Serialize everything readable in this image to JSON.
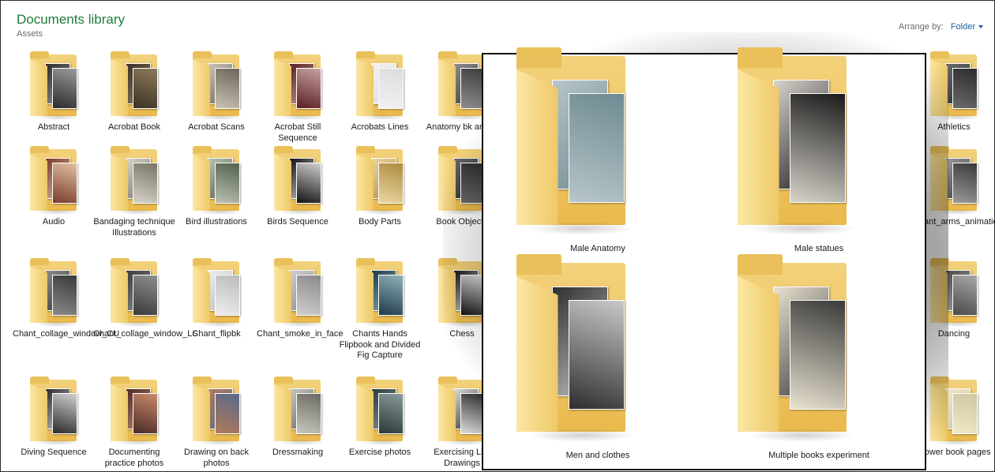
{
  "library": {
    "title": "Documents library",
    "subtitle": "Assets"
  },
  "arrange": {
    "label": "Arrange by:",
    "value": "Folder"
  },
  "folders": [
    {
      "label": "Abstract",
      "thumb": [
        "#2a2a2a",
        "#9a9a9a"
      ]
    },
    {
      "label": "Acrobat Book",
      "thumb": [
        "#3a3226",
        "#8d7a5a"
      ]
    },
    {
      "label": "Acrobat Scans",
      "thumb": [
        "#c9c2b5",
        "#6e6658"
      ]
    },
    {
      "label": "Acrobat Still Sequence",
      "thumb": [
        "#5a1e22",
        "#c7a2a0"
      ]
    },
    {
      "label": "Acrobats Lines",
      "thumb": [
        "#f2f2f2",
        "#dcdcdc"
      ]
    },
    {
      "label": "Anatomy bk artists",
      "thumb": [
        "#8d8d8d",
        "#3c3c3c"
      ]
    },
    {
      "label": "Athletics",
      "thumb": [
        "#6a6a6a",
        "#2c2c2c"
      ]
    },
    {
      "label": "Audio",
      "thumb": [
        "#7a3b2c",
        "#e0c0a0"
      ]
    },
    {
      "label": "Bandaging technique Illustrations",
      "thumb": [
        "#d7d3c8",
        "#7a7466"
      ]
    },
    {
      "label": "Bird illustrations",
      "thumb": [
        "#b9c1b2",
        "#556050"
      ]
    },
    {
      "label": "Birds Sequence",
      "thumb": [
        "#111111",
        "#cfcfcf"
      ]
    },
    {
      "label": "Body Parts",
      "thumb": [
        "#e8d8a0",
        "#b08a40"
      ]
    },
    {
      "label": "Book Objects",
      "thumb": [
        "#6a6a6a",
        "#2c2c2c"
      ]
    },
    {
      "label": "Chant_arms_animation",
      "thumb": [
        "#9a9a9a",
        "#3a3a3a"
      ]
    },
    {
      "label": "Chant_collage_window_CU",
      "thumb": [
        "#8a8a8a",
        "#3a3a3a"
      ]
    },
    {
      "label": "Chant_collage_window_LS",
      "thumb": [
        "#3a3a3a",
        "#8f8f8f"
      ]
    },
    {
      "label": "Chant_flipbk",
      "thumb": [
        "#ededed",
        "#bcbcbc"
      ]
    },
    {
      "label": "Chant_smoke_in_face",
      "thumb": [
        "#cfcfcf",
        "#8a8a8a"
      ]
    },
    {
      "label": "Chants Hands Flipbook and Divided Fig Capture",
      "thumb": [
        "#1f3a4a",
        "#8fb0b8"
      ]
    },
    {
      "label": "Chess",
      "thumb": [
        "#111111",
        "#e5e5e5"
      ]
    },
    {
      "label": "Dancing",
      "thumb": [
        "#4a4a4a",
        "#a8a8a8"
      ]
    },
    {
      "label": "Diving Sequence",
      "thumb": [
        "#2a2a2a",
        "#d0d0d0"
      ]
    },
    {
      "label": "Documenting practice photos",
      "thumb": [
        "#4a2a28",
        "#c98a6a"
      ]
    },
    {
      "label": "Drawing on back photos",
      "thumb": [
        "#b07a5a",
        "#5a6a8a"
      ]
    },
    {
      "label": "Dressmaking",
      "thumb": [
        "#c8c8c0",
        "#6a6a62"
      ]
    },
    {
      "label": "Exercise photos",
      "thumb": [
        "#2a3a3a",
        "#8a9a9a"
      ]
    },
    {
      "label": "Exercising Life Drawings",
      "thumb": [
        "#dcdcdc",
        "#2a2a2a"
      ]
    },
    {
      "label": "Flower book pages",
      "thumb": [
        "#f0e8c8",
        "#cfc6a2"
      ]
    }
  ],
  "zoom": {
    "folders": [
      {
        "label": "Male Anatomy",
        "thumb": [
          "#b7c6c9",
          "#6e8a92"
        ]
      },
      {
        "label": "Male statues",
        "thumb": [
          "#d8d4cc",
          "#1a1a1a"
        ]
      },
      {
        "label": "Men and clothes",
        "thumb": [
          "#2e2e2e",
          "#c9c9c9"
        ]
      },
      {
        "label": "Multiple books experiment",
        "thumb": [
          "#e8e2d0",
          "#3a3a3a"
        ]
      }
    ]
  },
  "colors": {
    "title": "#1e7b3a",
    "link": "#1d5fa8",
    "folder": "#f0c966"
  }
}
